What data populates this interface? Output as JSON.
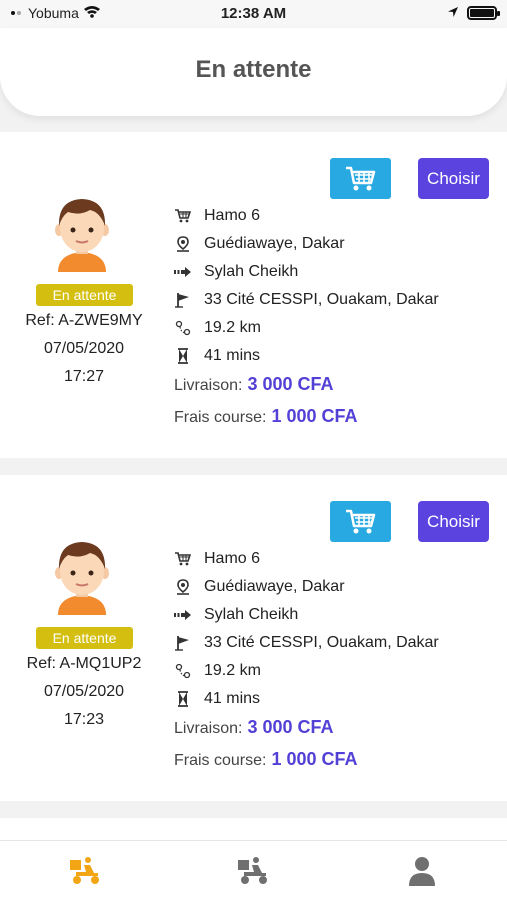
{
  "status_bar": {
    "carrier": "Yobuma",
    "time": "12:38 AM"
  },
  "header": {
    "title": "En attente"
  },
  "orders": [
    {
      "status": "En attente",
      "ref": "Ref: A-ZWE9MY",
      "date": "07/05/2020",
      "time": "17:27",
      "choose_label": "Choisir",
      "shop": "Hamo 6",
      "pickup": "Guédiawaye, Dakar",
      "customer": "Sylah Cheikh",
      "destination": "33 Cité CESSPI, Ouakam, Dakar",
      "distance": "19.2 km",
      "duration": "41 mins",
      "delivery_label": "Livraison:",
      "delivery_value": "3 000 CFA",
      "fee_label": "Frais course:",
      "fee_value": "1 000 CFA"
    },
    {
      "status": "En attente",
      "ref": "Ref: A-MQ1UP2",
      "date": "07/05/2020",
      "time": "17:23",
      "choose_label": "Choisir",
      "shop": "Hamo 6",
      "pickup": "Guédiawaye, Dakar",
      "customer": "Sylah Cheikh",
      "destination": "33 Cité CESSPI, Ouakam, Dakar",
      "distance": "19.2 km",
      "duration": "41 mins",
      "delivery_label": "Livraison:",
      "delivery_value": "3 000 CFA",
      "fee_label": "Frais course:",
      "fee_value": "1 000 CFA"
    }
  ],
  "tabs": [
    {
      "icon": "scooter-delivery-icon",
      "active": true
    },
    {
      "icon": "scooter-delivery-icon",
      "active": false
    },
    {
      "icon": "person-icon",
      "active": false
    }
  ],
  "colors": {
    "accent_blue": "#29a9e1",
    "choose_purple": "#5b43e0",
    "price_purple": "#5340d6",
    "badge_yellow": "#d4bf10",
    "tab_active": "#f2a515",
    "tab_inactive": "#6f6f6f"
  }
}
